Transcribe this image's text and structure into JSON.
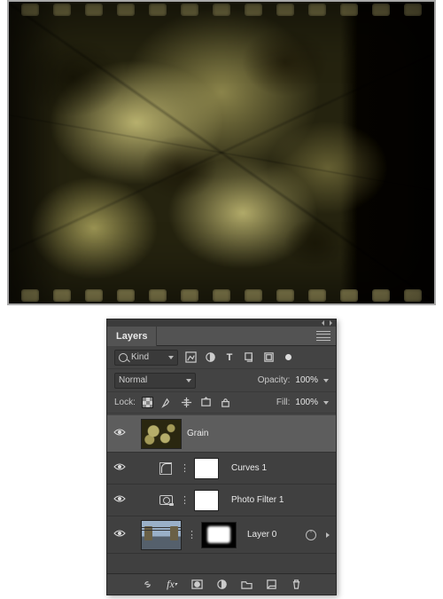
{
  "panel": {
    "title": "Layers",
    "filter": {
      "kind_label": "Kind"
    },
    "blend": {
      "mode": "Normal",
      "opacity_label": "Opacity:",
      "opacity_value": "100%"
    },
    "lock": {
      "label": "Lock:",
      "fill_label": "Fill:",
      "fill_value": "100%"
    },
    "filter_icons": [
      "pixel-layer",
      "adjustment-layer",
      "type-layer",
      "shape-layer",
      "smart-object",
      "artboard"
    ]
  },
  "layers": [
    {
      "name": "Grain",
      "visible": true,
      "selected": true,
      "kind": "pixel",
      "thumb": "grain"
    },
    {
      "name": "Curves 1",
      "visible": true,
      "selected": false,
      "kind": "adjustment",
      "icon": "curves",
      "mask": "white"
    },
    {
      "name": "Photo Filter 1",
      "visible": true,
      "selected": false,
      "kind": "adjustment",
      "icon": "photofilter",
      "mask": "white"
    },
    {
      "name": "Layer 0",
      "visible": true,
      "selected": false,
      "kind": "pixel",
      "thumb": "photo",
      "mask": "soft"
    }
  ],
  "bottombar_icons": [
    "link",
    "fx",
    "mask",
    "adjustment",
    "group",
    "new-layer",
    "delete"
  ]
}
